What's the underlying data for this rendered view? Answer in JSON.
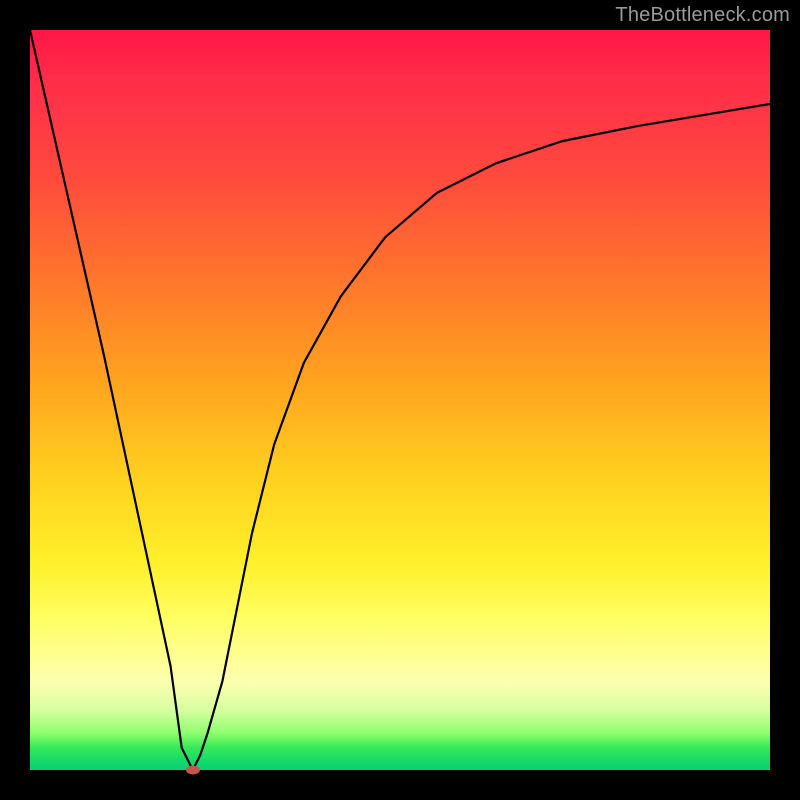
{
  "attribution": "TheBottleneck.com",
  "chart_data": {
    "type": "line",
    "title": "",
    "xlabel": "",
    "ylabel": "",
    "xlim": [
      0,
      100
    ],
    "ylim": [
      0,
      100
    ],
    "series": [
      {
        "name": "curve",
        "x": [
          0,
          5,
          10,
          13,
          16,
          19,
          20.5,
          22,
          23,
          24,
          26,
          28,
          30,
          33,
          37,
          42,
          48,
          55,
          63,
          72,
          82,
          91,
          100
        ],
        "values": [
          100,
          78,
          56,
          42,
          28,
          14,
          3,
          0,
          2,
          5,
          12,
          22,
          32,
          44,
          55,
          64,
          72,
          78,
          82,
          85,
          87,
          88.5,
          90
        ]
      }
    ],
    "marker": {
      "x": 22,
      "y": 0,
      "color": "#c5564f"
    },
    "gradient_stops": [
      {
        "pct": 0,
        "color": "#ff1744"
      },
      {
        "pct": 20,
        "color": "#ff4a3d"
      },
      {
        "pct": 48,
        "color": "#ffa51f"
      },
      {
        "pct": 72,
        "color": "#fff02a"
      },
      {
        "pct": 88,
        "color": "#fdffb0"
      },
      {
        "pct": 97,
        "color": "#35e85a"
      },
      {
        "pct": 100,
        "color": "#0bcf75"
      }
    ]
  }
}
